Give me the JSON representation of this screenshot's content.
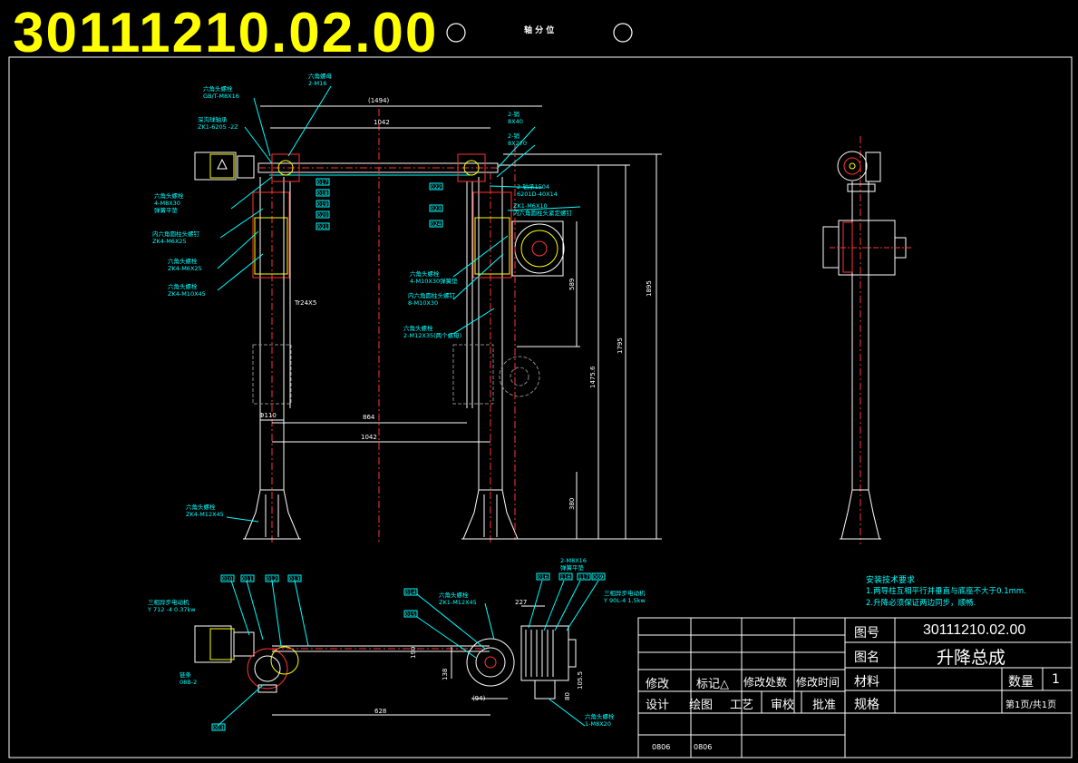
{
  "drawing": {
    "number": "30111210.02.00",
    "small_header": "轴 分 位",
    "notes_title": "安装技术要求",
    "notes": [
      "1.两导柱互相平行并垂直与底座不大于0.1mm.",
      "2.升降必须保证两边同步，顺畅."
    ],
    "dims": {
      "d1494": "(1494)",
      "d1042": "1042",
      "d864": "864",
      "d1042b": "1042",
      "d110": "Φ110",
      "d1795": "1795",
      "d1475": "1475.6",
      "d1895": "1895",
      "d589": "589",
      "d380": "380",
      "tr": "Tr24X5",
      "d628": "628",
      "d94": "(94)",
      "d227": "227",
      "d105": "105.5",
      "d80": "80",
      "d138": "138",
      "d190": "190"
    },
    "callouts": {
      "c1": "六角头螺栓",
      "c1b": "GB/T-M8X16",
      "c2": "六角螺母",
      "c2b": "2-M16",
      "c3": "深沟球轴承",
      "c3b": "ZK1-6205 -2Z",
      "c4": "六角头螺栓",
      "c4b": "4-M8X30",
      "c4c": "弹簧平垫",
      "c4d": "2-M8X30",
      "c5": "内六角圆柱头螺钉",
      "c5b": "ZK4-M6X25",
      "c6": "六角头螺栓",
      "c6b": "ZK4-M6X25",
      "c7": "六角头螺栓",
      "c7b": "ZK4-M10X45",
      "c8": "2-销",
      "c8b": "8X40",
      "c9": "2-销",
      "c9b": "8X270",
      "c10": "2-轴承1504",
      "c10b": "6201D-40X14",
      "c11": "ZK1-M6X10",
      "c11b": "内六角圆柱头紧定螺钉",
      "c12": "六角头螺栓",
      "c12b": "4-M10X30弹簧垫",
      "c13": "内六角圆柱头螺钉",
      "c13b": "8-M10X30",
      "c14": "六角头螺栓",
      "c14b": "2-M12X35(两个螺母)",
      "c15": "六角头螺栓",
      "c15b": "ZK4-M12X45",
      "c16": "三相异步电动机",
      "c16b": "Y 712 -4  0.37kw",
      "c17": "链条",
      "c17b": "08B-2",
      "c18": "六角头螺栓",
      "c18b": "ZK1-M12X45",
      "c19": "2-M8X16",
      "c19b": "弹簧平垫",
      "c20": "三相异步电动机",
      "c20b": "Y 90L-4 1.5kw",
      "c21": "六角头螺栓",
      "c21b": "1-M8X20",
      "p1": "017",
      "p2": "018",
      "p3": "019",
      "p4": "020",
      "p5": "021",
      "p6": "022",
      "p7": "023",
      "p8": "024",
      "p9": "010",
      "p10": "011",
      "p11": "012",
      "p12": "013",
      "p13": "014",
      "p14": "015",
      "p15": "016",
      "p16": "116",
      "p17": "117",
      "p18": "009",
      "p19": "003"
    }
  },
  "title_block": {
    "label_number": "图号",
    "value_number": "30111210.02.00",
    "label_name": "图名",
    "value_name": "升降总成",
    "label_material": "材料",
    "label_qty": "数量",
    "value_qty": "1",
    "label_spec": "规格",
    "value_sheet": "第1页/共1页",
    "rev": [
      "修改",
      "标记△",
      "修改处数",
      "修改时间"
    ],
    "roles": [
      "设计",
      "绘图",
      "工艺",
      "审校",
      "批准"
    ],
    "dates": [
      "0806",
      "0806"
    ]
  }
}
